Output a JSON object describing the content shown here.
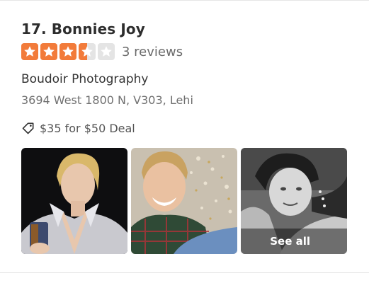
{
  "listing": {
    "title": "17. Bonnies Joy",
    "rating": {
      "value": 3.5,
      "max": 5,
      "review_count_label": "3 reviews"
    },
    "category": "Boudoir Photography",
    "address": "3694 West 1800 N, V303, Lehi",
    "deal": {
      "icon": "tag-icon",
      "label": "$35 for $50 Deal"
    },
    "photos": {
      "see_all_label": "See all"
    }
  },
  "colors": {
    "star_filled": "#f27b3a",
    "star_empty": "#e4e4e4"
  }
}
